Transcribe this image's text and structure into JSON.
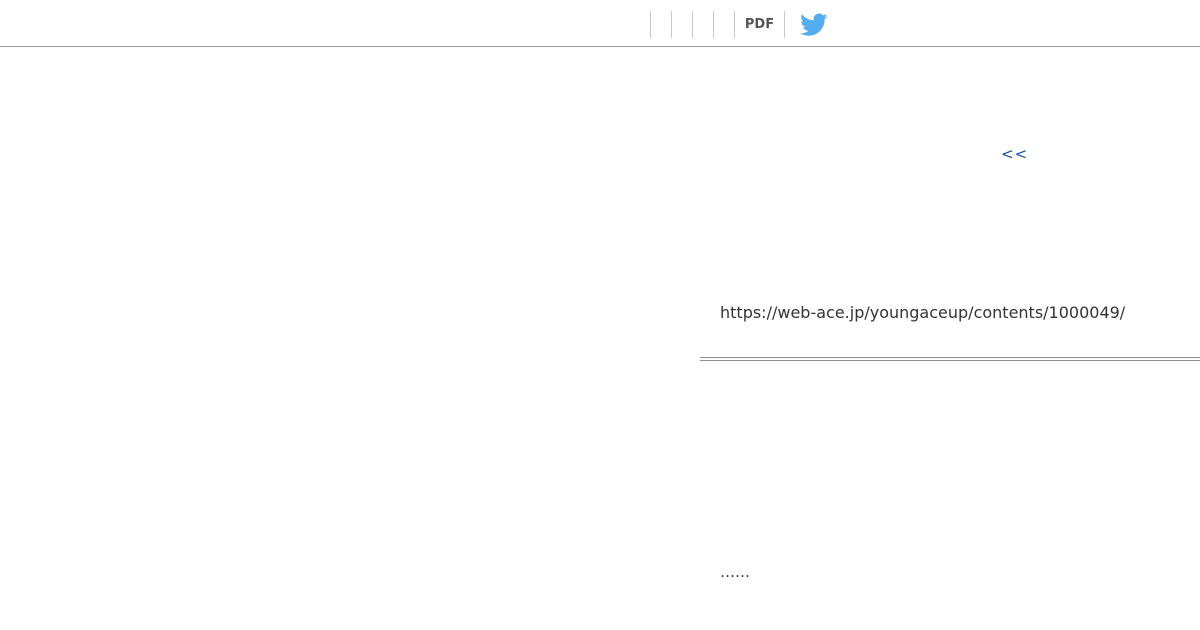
{
  "toolbar": {
    "pdf_label": "PDF",
    "twitter_icon": "twitter-bird-icon",
    "twitter_color": "#55acee"
  },
  "content": {
    "back_link": "<<",
    "url": "https://web-ace.jp/youngaceup/contents/1000049/",
    "ellipsis": "……"
  }
}
